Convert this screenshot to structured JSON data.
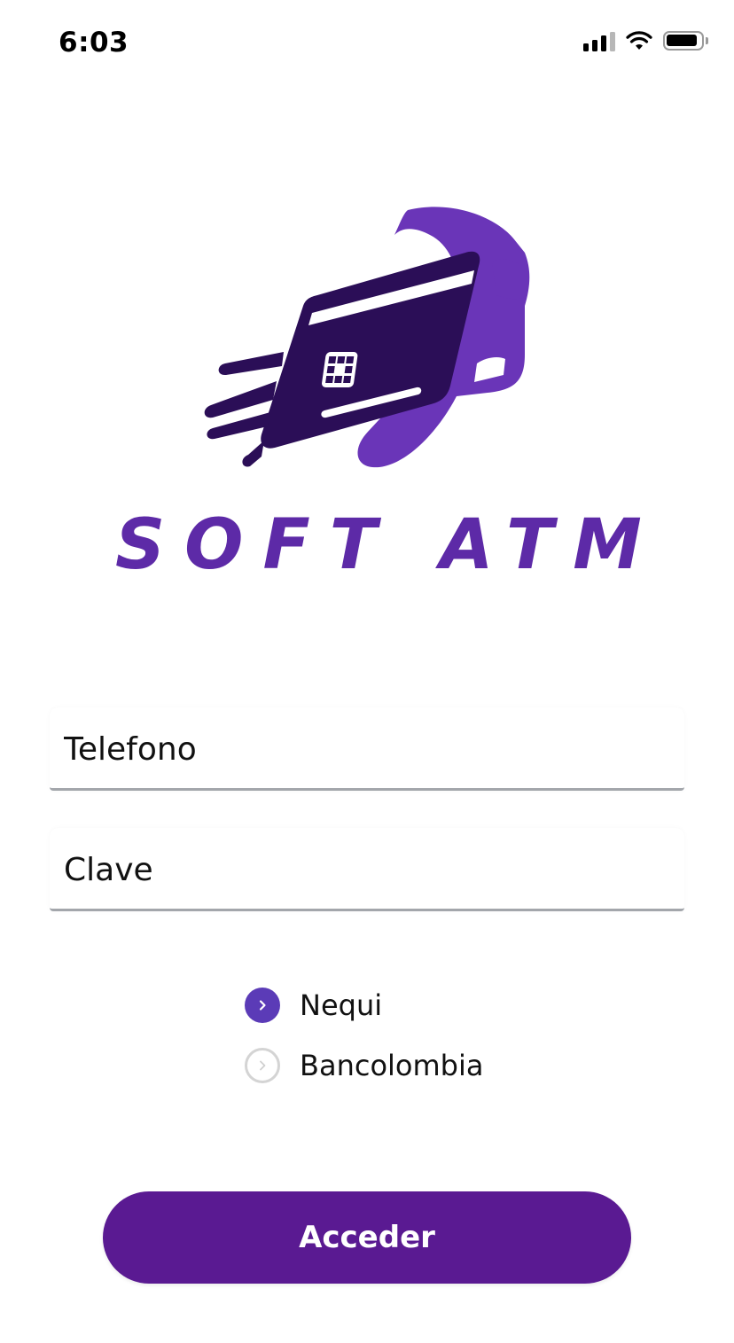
{
  "status_bar": {
    "time": "6:03",
    "icons": [
      "signal-icon",
      "wifi-icon",
      "battery-icon"
    ]
  },
  "logo": {
    "wordmark": "SOFT ATM",
    "icon": "credit-card-speed-icon",
    "colors": {
      "primary": "#5d2aa7",
      "dark": "#2b0e57"
    }
  },
  "form": {
    "phone": {
      "placeholder": "Telefono",
      "value": ""
    },
    "password": {
      "placeholder": "Clave",
      "value": ""
    },
    "options": [
      {
        "label": "Nequi",
        "selected": true
      },
      {
        "label": "Bancolombia",
        "selected": false
      }
    ],
    "submit_label": "Acceder"
  },
  "colors": {
    "accent": "#5b3bb7",
    "button": "#5a1a92",
    "underline": "#a3a6ab"
  }
}
